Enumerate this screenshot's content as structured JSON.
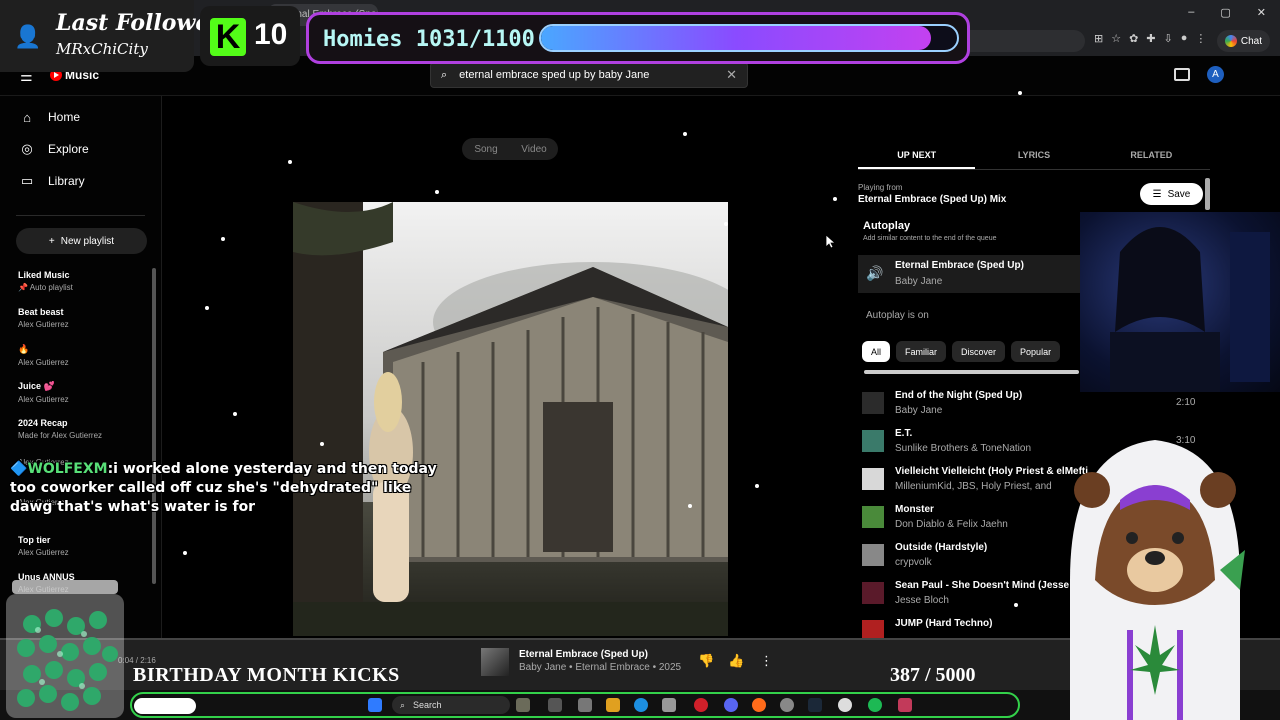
{
  "browser": {
    "tab_title": "Eternal Embrace (Sped Up)",
    "window_controls": [
      "–",
      "▢",
      "✕"
    ],
    "chat_label": "Chat"
  },
  "overlay": {
    "follower_label": "Last Follower",
    "follower_name": "MRxChiCity",
    "kick_count": "10",
    "homies_label": "Homies 1031/1100",
    "homies_progress": 0.937,
    "chat_user": "WOLFEXM",
    "chat_message": "i worked alone yesterday and then today too coworker called off cuz she's \"dehydrated\" like dawg that's what's water is for",
    "birthday_text": "BIRTHDAY MONTH KICKS",
    "goal_text": "387  / 5000"
  },
  "header": {
    "logo_text": "Music",
    "search_query": "eternal embrace sped up by baby Jane",
    "account_initial": "A"
  },
  "sidebar": {
    "nav": [
      {
        "label": "Home",
        "icon": "home-icon",
        "glyph": "⌂"
      },
      {
        "label": "Explore",
        "icon": "compass-icon",
        "glyph": "◎"
      },
      {
        "label": "Library",
        "icon": "bookmark-icon",
        "glyph": "▭"
      }
    ],
    "new_playlist": "New playlist",
    "playlists": [
      {
        "title": "Liked Music",
        "sub": "Auto playlist"
      },
      {
        "title": "Beat beast",
        "sub": "Alex Gutierrez"
      },
      {
        "title": "🔥",
        "sub": "Alex Gutierrez"
      },
      {
        "title": "Juice 💕",
        "sub": "Alex Gutierrez"
      },
      {
        "title": "2024 Recap",
        "sub": "Made for Alex Gutierrez"
      },
      {
        "title": "",
        "sub": "Alex Gutierrez"
      },
      {
        "title": "",
        "sub": "Alex Gutierrez"
      },
      {
        "title": "Top tier",
        "sub": "Alex Gutierrez"
      },
      {
        "title": "Unus ANNUS",
        "sub": "Alex Gutierrez"
      }
    ]
  },
  "main": {
    "toggle": [
      "Song",
      "Video"
    ]
  },
  "right_panel": {
    "tabs": [
      "UP NEXT",
      "LYRICS",
      "RELATED"
    ],
    "playing_from_label": "Playing from",
    "playing_from": "Eternal Embrace (Sped Up) Mix",
    "save_label": "Save",
    "autoplay_title": "Autoplay",
    "autoplay_sub": "Add similar content to the end of the queue",
    "current": {
      "title": "Eternal Embrace (Sped Up)",
      "artist": "Baby Jane"
    },
    "autoplay_on": "Autoplay is on",
    "chips": [
      "All",
      "Familiar",
      "Discover",
      "Popular"
    ],
    "queue": [
      {
        "title": "End of the Night (Sped Up)",
        "artist": "Baby Jane",
        "duration": "2:10",
        "color": "#2b2b2b"
      },
      {
        "title": "E.T.",
        "artist": "Sunlike Brothers & ToneNation",
        "duration": "3:10",
        "color": "#3a7a6a"
      },
      {
        "title": "Vielleicht Vielleicht (Holy Priest & elMefti",
        "artist": "MilleniumKid, JBS, Holy Priest, and",
        "duration": "",
        "color": "#d8d8d8"
      },
      {
        "title": "Monster",
        "artist": "Don Diablo & Felix Jaehn",
        "duration": "",
        "color": "#4a8a3a"
      },
      {
        "title": "Outside (Hardstyle)",
        "artist": "crypvolk",
        "duration": "",
        "color": "#888888"
      },
      {
        "title": "Sean Paul - She Doesn't Mind (Jesse Bl",
        "artist": "Jesse Bloch",
        "duration": "",
        "color": "#5a1a2a"
      },
      {
        "title": "JUMP (Hard Techno)",
        "artist": "",
        "duration": "",
        "color": "#b02020"
      }
    ]
  },
  "player": {
    "time": "0:04 / 2:16",
    "title": "Eternal Embrace (Sped Up)",
    "meta": "Baby Jane • Eternal Embrace • 2025"
  },
  "taskbar": {
    "search_label": "Search"
  }
}
